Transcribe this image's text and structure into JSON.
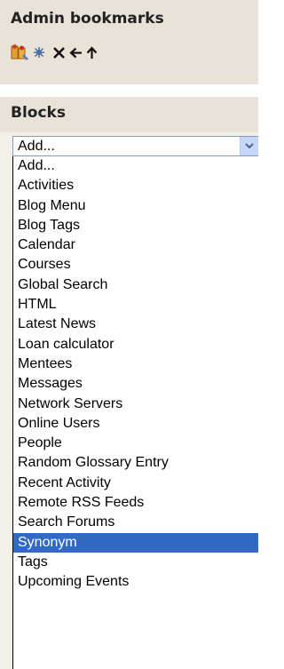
{
  "admin_bookmarks": {
    "title": "Admin bookmarks",
    "icons": [
      "people-edit-icon",
      "settings-icon",
      "delete-icon",
      "move-left-icon",
      "move-up-icon"
    ]
  },
  "blocks": {
    "title": "Blocks",
    "select": {
      "selected_value": "Add...",
      "options": [
        "Add...",
        "Activities",
        "Blog Menu",
        "Blog Tags",
        "Calendar",
        "Courses",
        "Global Search",
        "HTML",
        "Latest News",
        "Loan calculator",
        "Mentees",
        "Messages",
        "Network Servers",
        "Online Users",
        "People",
        "Random Glossary Entry",
        "Recent Activity",
        "Remote RSS Feeds",
        "Search Forums",
        "Synonym",
        "Tags",
        "Upcoming Events"
      ],
      "highlighted_option": "Synonym"
    }
  },
  "colors": {
    "header_bg": "#e8e2d9",
    "body_bg": "#f3efe9",
    "highlight": "#316ac5"
  }
}
